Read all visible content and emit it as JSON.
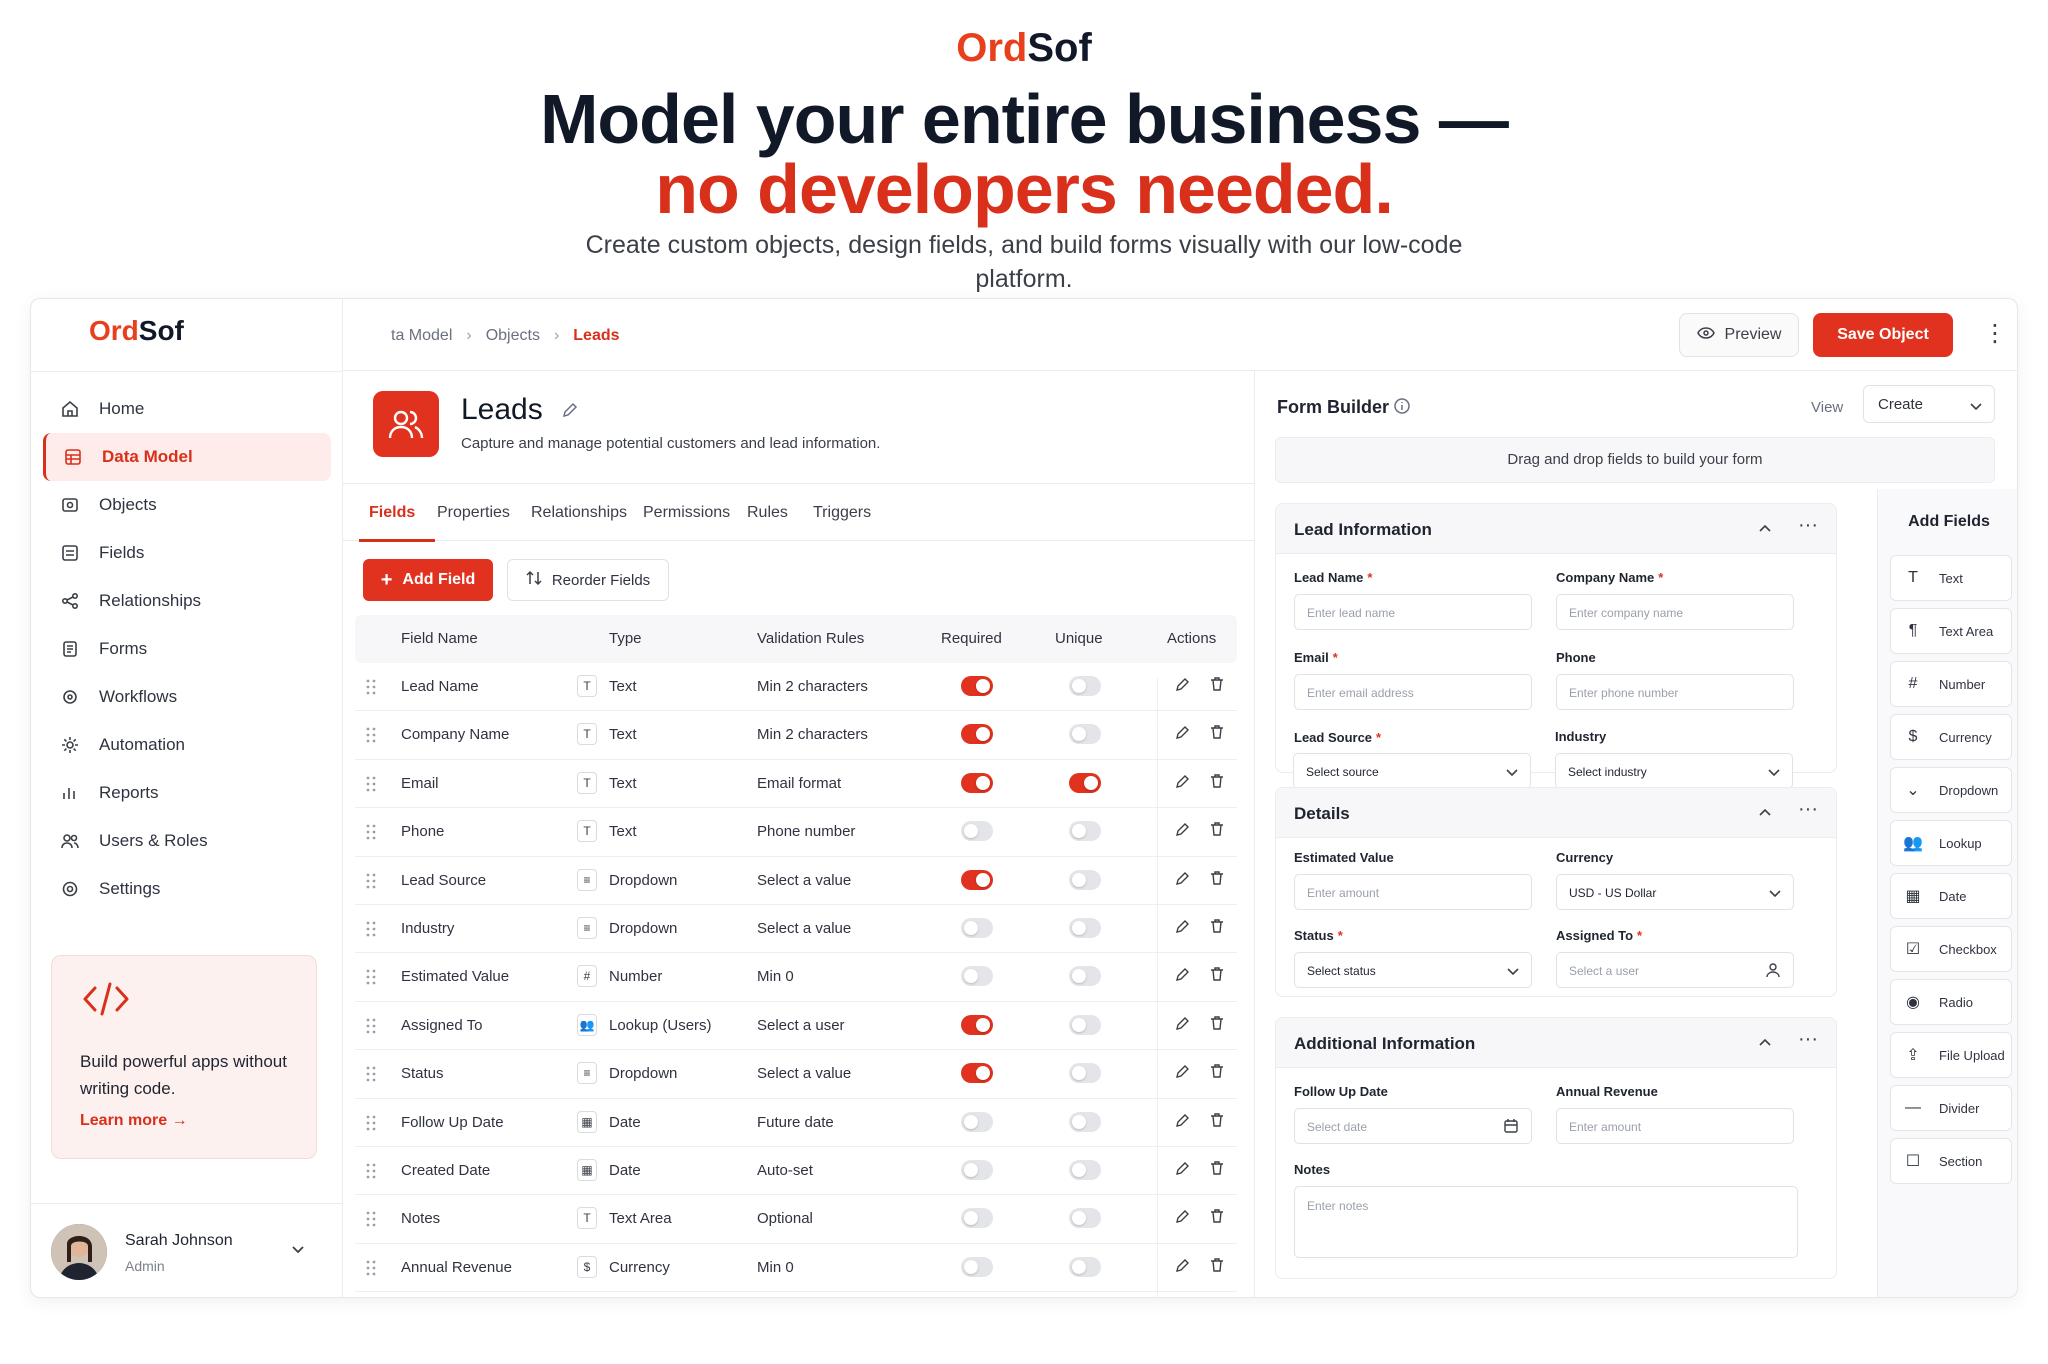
{
  "hero": {
    "logo_a": "Ord",
    "logo_b": "Sof",
    "headline": "Model your entire business —",
    "headline_accent": "no developers needed.",
    "subtitle": "Create custom objects, design fields, and build forms visually with our low-code platform."
  },
  "brand": {
    "name_a": "Ord",
    "name_b": "Sof",
    "accent": "#e0321e"
  },
  "sidebar": {
    "items": [
      {
        "label": "Home",
        "icon": "home-icon"
      },
      {
        "label": "Data Model",
        "icon": "database-icon",
        "active": true
      },
      {
        "label": "Objects",
        "icon": "cube-icon"
      },
      {
        "label": "Fields",
        "icon": "list-icon"
      },
      {
        "label": "Relationships",
        "icon": "share-icon"
      },
      {
        "label": "Forms",
        "icon": "form-icon"
      },
      {
        "label": "Workflows",
        "icon": "workflow-icon"
      },
      {
        "label": "Automation",
        "icon": "gear-icon"
      },
      {
        "label": "Reports",
        "icon": "chart-icon"
      },
      {
        "label": "Users & Roles",
        "icon": "users-icon"
      },
      {
        "label": "Settings",
        "icon": "settings-icon"
      }
    ],
    "promo": {
      "text": "Build powerful apps without writing code.",
      "link": "Learn more"
    },
    "user": {
      "name": "Sarah Johnson",
      "role": "Admin"
    }
  },
  "topbar": {
    "breadcrumb": [
      "ta Model",
      "Objects",
      "Leads"
    ],
    "preview": "Preview",
    "save": "Save Object"
  },
  "object": {
    "title": "Leads",
    "description": "Capture and manage potential customers and lead information."
  },
  "tabs": [
    "Fields",
    "Properties",
    "Relationships",
    "Permissions",
    "Rules",
    "Triggers"
  ],
  "actions": {
    "add_field": "Add Field",
    "reorder": "Reorder Fields"
  },
  "table": {
    "headers": [
      "Field Name",
      "Type",
      "Validation Rules",
      "Required",
      "Unique",
      "Actions"
    ],
    "rows": [
      {
        "name": "Lead Name",
        "icon": "T",
        "type": "Text",
        "validation": "Min 2 characters",
        "required": true,
        "unique": false
      },
      {
        "name": "Company Name",
        "icon": "T",
        "type": "Text",
        "validation": "Min 2 characters",
        "required": true,
        "unique": false
      },
      {
        "name": "Email",
        "icon": "T",
        "type": "Text",
        "validation": "Email format",
        "required": true,
        "unique": true
      },
      {
        "name": "Phone",
        "icon": "T",
        "type": "Text",
        "validation": "Phone number",
        "required": false,
        "unique": false
      },
      {
        "name": "Lead Source",
        "icon": "≡",
        "type": "Dropdown",
        "validation": "Select a value",
        "required": true,
        "unique": false
      },
      {
        "name": "Industry",
        "icon": "≡",
        "type": "Dropdown",
        "validation": "Select a value",
        "required": false,
        "unique": false
      },
      {
        "name": "Estimated Value",
        "icon": "#",
        "type": "Number",
        "validation": "Min 0",
        "required": false,
        "unique": false
      },
      {
        "name": "Assigned To",
        "icon": "👥",
        "type": "Lookup (Users)",
        "validation": "Select a user",
        "required": true,
        "unique": false
      },
      {
        "name": "Status",
        "icon": "≡",
        "type": "Dropdown",
        "validation": "Select a value",
        "required": true,
        "unique": false
      },
      {
        "name": "Follow Up Date",
        "icon": "▦",
        "type": "Date",
        "validation": "Future date",
        "required": false,
        "unique": false
      },
      {
        "name": "Created Date",
        "icon": "▦",
        "type": "Date",
        "validation": "Auto-set",
        "required": false,
        "unique": false
      },
      {
        "name": "Notes",
        "icon": "T",
        "type": "Text Area",
        "validation": "Optional",
        "required": false,
        "unique": false
      },
      {
        "name": "Annual Revenue",
        "icon": "$",
        "type": "Currency",
        "validation": "Min 0",
        "required": false,
        "unique": false
      }
    ]
  },
  "form_builder": {
    "title": "Form Builder",
    "view_label": "View",
    "view_value": "Create",
    "drop_hint": "Drag and drop fields to build your form",
    "sections": {
      "lead": {
        "title": "Lead Information",
        "fields": [
          {
            "label": "Lead Name",
            "placeholder": "Enter lead name",
            "required": true
          },
          {
            "label": "Company Name",
            "placeholder": "Enter company name",
            "required": true
          },
          {
            "label": "Email",
            "placeholder": "Enter email address",
            "required": true
          },
          {
            "label": "Phone",
            "placeholder": "Enter phone number",
            "required": false
          },
          {
            "label": "Lead Source",
            "placeholder": "Select source",
            "required": true
          },
          {
            "label": "Industry",
            "placeholder": "Select industry",
            "required": false
          }
        ]
      },
      "details": {
        "title": "Details",
        "fields": [
          {
            "label": "Estimated Value",
            "placeholder": "Enter amount",
            "required": false
          },
          {
            "label": "Currency",
            "placeholder": "USD - US Dollar",
            "required": false
          },
          {
            "label": "Status",
            "placeholder": "Select status",
            "required": true
          },
          {
            "label": "Assigned To",
            "placeholder": "Select a user",
            "required": true
          }
        ]
      },
      "additional": {
        "title": "Additional Information",
        "fields": [
          {
            "label": "Follow Up Date",
            "placeholder": "Select date",
            "required": false
          },
          {
            "label": "Annual Revenue",
            "placeholder": "Enter amount",
            "required": false
          },
          {
            "label": "Notes",
            "placeholder": "Enter notes",
            "required": false
          }
        ]
      }
    },
    "add_fields": {
      "title": "Add Fields",
      "items": [
        "Text",
        "Text Area",
        "Number",
        "Currency",
        "Dropdown",
        "Lookup",
        "Date",
        "Checkbox",
        "Radio",
        "File Upload",
        "Divider",
        "Section"
      ]
    }
  }
}
